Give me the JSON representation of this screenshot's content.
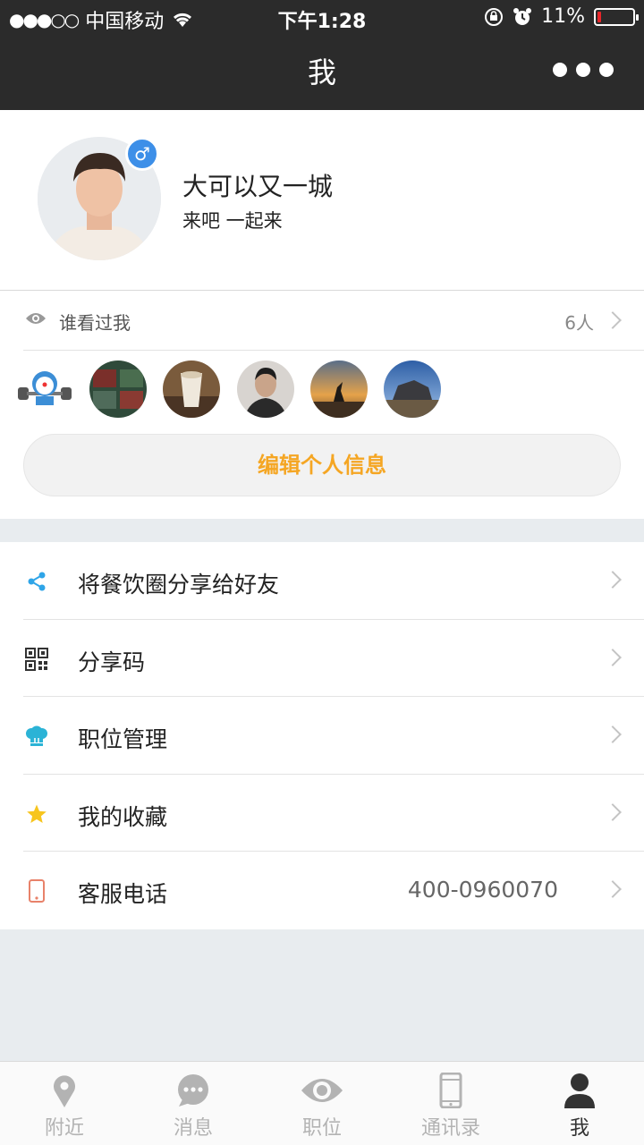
{
  "status_bar": {
    "signal": "●●●○○",
    "carrier": "中国移动",
    "time": "下午1:28",
    "battery": "11%",
    "battery_level": 0.11
  },
  "nav": {
    "title": "我"
  },
  "profile": {
    "gender_symbol": "♂",
    "name": "大可以又一城",
    "motto": "来吧 一起来"
  },
  "visitors": {
    "label": "谁看过我",
    "count": "6人",
    "edit_button": "编辑个人信息"
  },
  "menu": {
    "items": [
      {
        "label": "将餐饮圈分享给好友",
        "icon": "share-icon"
      },
      {
        "label": "分享码",
        "icon": "qrcode-icon"
      },
      {
        "label": "职位管理",
        "icon": "chef-hat-icon"
      },
      {
        "label": "我的收藏",
        "icon": "star-icon"
      },
      {
        "label": "客服电话",
        "value": "400-0960070",
        "icon": "phone-icon"
      }
    ]
  },
  "tabs": [
    {
      "label": "附近",
      "icon": "location-pin-icon",
      "active": false
    },
    {
      "label": "消息",
      "icon": "chat-bubble-icon",
      "active": false
    },
    {
      "label": "职位",
      "icon": "eye-icon",
      "active": false
    },
    {
      "label": "通讯录",
      "icon": "mobile-phone-icon",
      "active": false
    },
    {
      "label": "我",
      "icon": "person-icon",
      "active": true
    }
  ],
  "colors": {
    "header": "#2b2b2b",
    "accent": "#f5a623",
    "gender": "#3d8fe8",
    "battery_low": "#e8262a",
    "share": "#2fa5e8",
    "star": "#f7c51e",
    "phone": "#e8826a"
  }
}
